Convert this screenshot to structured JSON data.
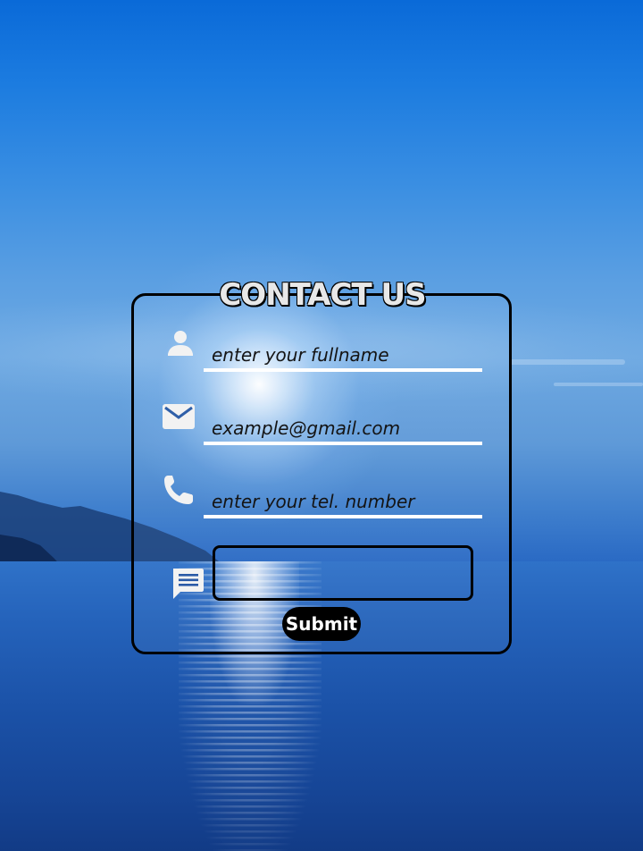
{
  "form": {
    "title": "CONTACT US",
    "fields": [
      {
        "icon": "person-icon",
        "placeholder": "enter your fullname"
      },
      {
        "icon": "mail-icon",
        "placeholder": "example@gmail.com"
      },
      {
        "icon": "phone-icon",
        "placeholder": "enter your tel. number"
      }
    ],
    "message": {
      "icon": "chat-message-icon",
      "value": ""
    },
    "submit_label": "Submit"
  },
  "colors": {
    "accent": "#000000",
    "field_underline": "#ffffff",
    "icon_color": "#f2f2f2"
  }
}
